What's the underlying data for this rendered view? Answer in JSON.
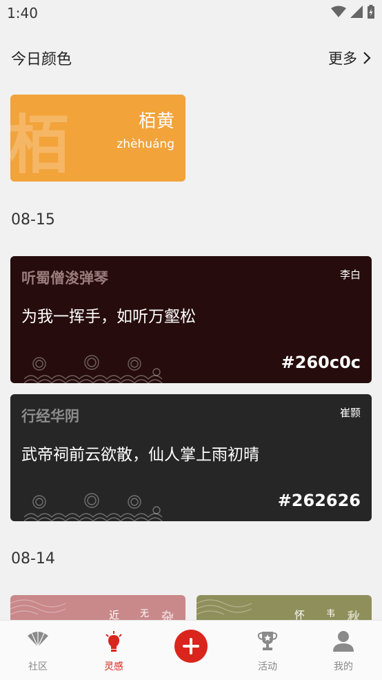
{
  "status": {
    "time": "1:40"
  },
  "today": {
    "header": "今日颜色",
    "more": "更多",
    "card": {
      "big_char": "栢",
      "name": "栢黄",
      "pinyin": "zhèhuáng",
      "color": "#f2a33a"
    }
  },
  "sections": [
    {
      "date": "08-15",
      "cards": [
        {
          "title": "听蜀僧浚弹琴",
          "author": "李白",
          "line": "为我一挥手，如听万壑松",
          "hex": "#260c0c",
          "background": "#260c0c",
          "title_color": "#9b7c7c"
        },
        {
          "title": "行经华阴",
          "author": "崔颢",
          "line": "武帝祠前云欲散，仙人掌上雨初晴",
          "hex": "#262626",
          "background": "#262626",
          "title_color": "#8c8c8c"
        }
      ]
    },
    {
      "date": "08-14",
      "previews": [
        {
          "text_a": "近",
          "text_b": "无",
          "text_c": "杂",
          "color": "#c9888a"
        },
        {
          "text_a": "怀",
          "text_b": "韦",
          "text_c": "秋",
          "color": "#8e8f5a"
        }
      ]
    }
  ],
  "tabbar": {
    "tabs": [
      {
        "label": "社区",
        "icon": "fan-icon"
      },
      {
        "label": "灵感",
        "icon": "lightbulb-icon"
      },
      {
        "label": "",
        "icon": "add-icon"
      },
      {
        "label": "活动",
        "icon": "trophy-icon"
      },
      {
        "label": "我的",
        "icon": "person-icon"
      }
    ],
    "active_color": "#d8261e"
  }
}
